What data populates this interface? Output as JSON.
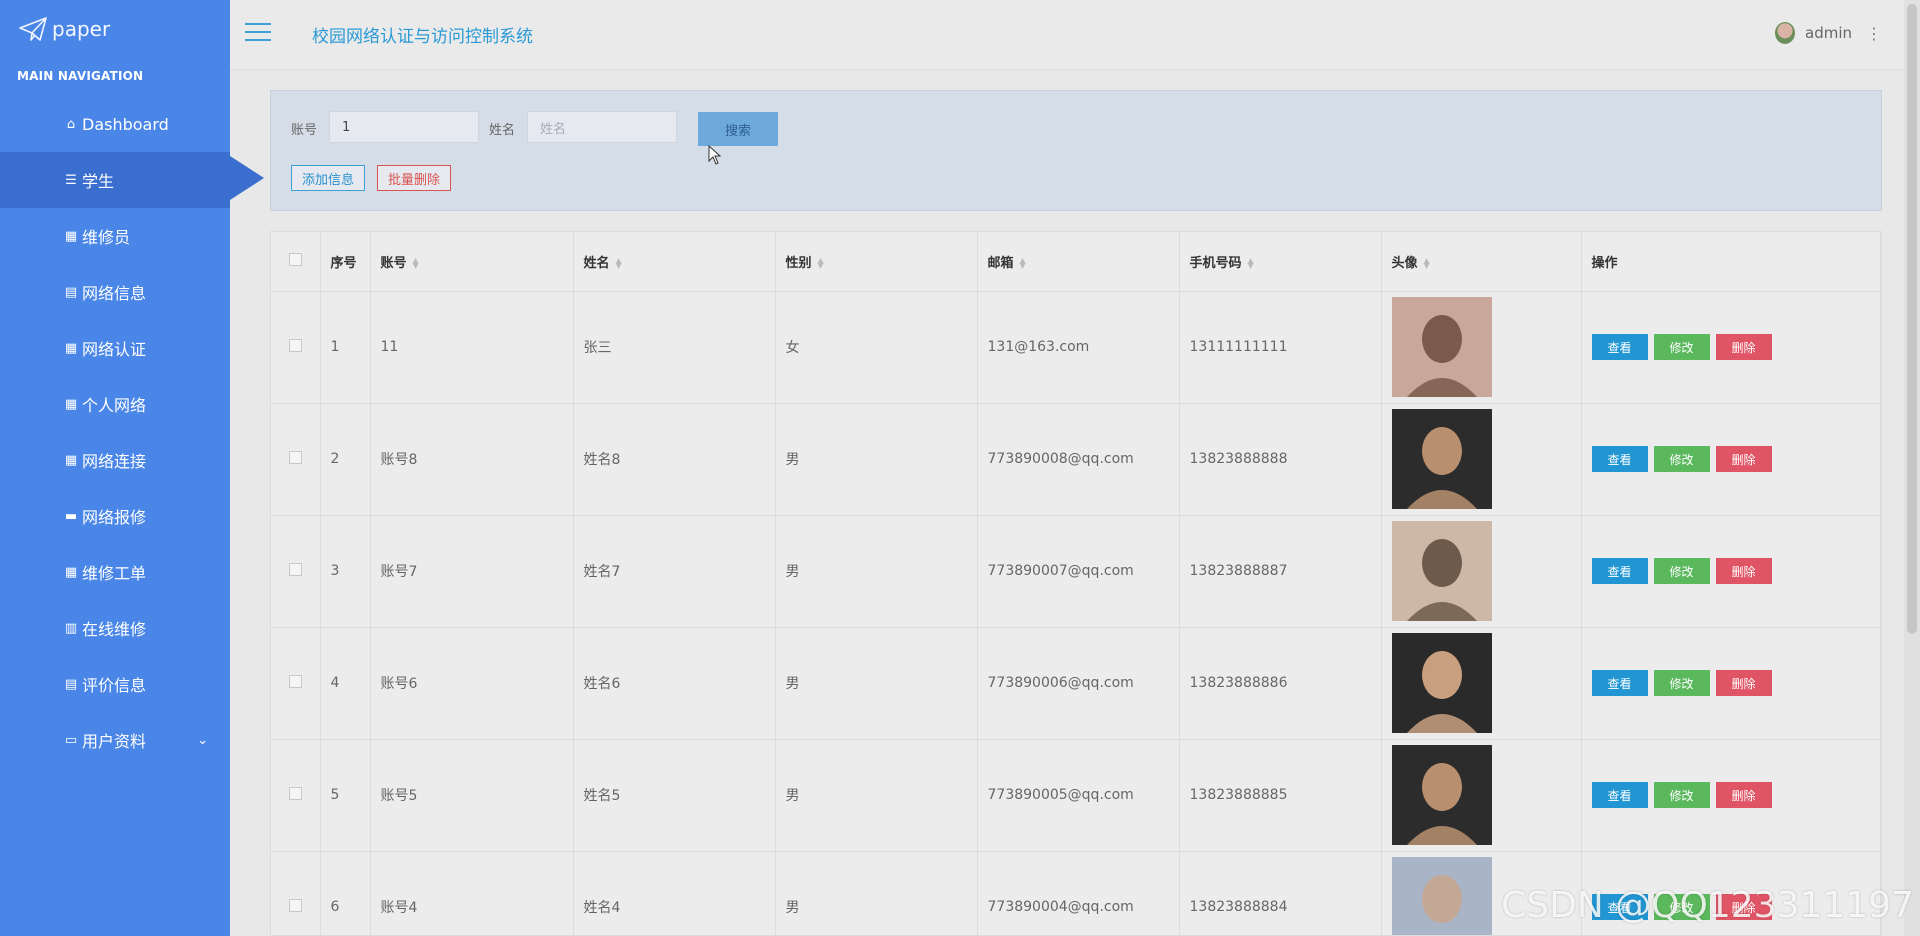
{
  "app": {
    "logo_text": "paper",
    "title": "校园网络认证与访问控制系统"
  },
  "sidebar": {
    "section_title": "MAIN NAVIGATION",
    "items": [
      {
        "label": "Dashboard",
        "icon": "home-icon"
      },
      {
        "label": "学生",
        "icon": "list-icon",
        "active": true
      },
      {
        "label": "维修员",
        "icon": "grid-icon"
      },
      {
        "label": "网络信息",
        "icon": "clipboard-icon"
      },
      {
        "label": "网络认证",
        "icon": "grid-icon"
      },
      {
        "label": "个人网络",
        "icon": "grid-icon"
      },
      {
        "label": "网络连接",
        "icon": "grid-icon"
      },
      {
        "label": "网络报修",
        "icon": "briefcase-icon"
      },
      {
        "label": "维修工单",
        "icon": "grid-icon"
      },
      {
        "label": "在线维修",
        "icon": "book-icon"
      },
      {
        "label": "评价信息",
        "icon": "clipboard-icon"
      },
      {
        "label": "用户资料",
        "icon": "card-icon",
        "has_children": true
      }
    ]
  },
  "user": {
    "name": "admin"
  },
  "search": {
    "account_label": "账号",
    "account_value": "1",
    "name_label": "姓名",
    "name_placeholder": "姓名",
    "search_button": "搜索",
    "add_button": "添加信息",
    "batch_delete_button": "批量删除"
  },
  "table": {
    "headers": {
      "index": "序号",
      "account": "账号",
      "name": "姓名",
      "gender": "性别",
      "email": "邮箱",
      "phone": "手机号码",
      "avatar": "头像",
      "actions": "操作"
    },
    "actions": {
      "view": "查看",
      "edit": "修改",
      "delete": "删除"
    },
    "rows": [
      {
        "index": "1",
        "account": "11",
        "name": "张三",
        "gender": "女",
        "email": "131@163.com",
        "phone": "13111111111"
      },
      {
        "index": "2",
        "account": "账号8",
        "name": "姓名8",
        "gender": "男",
        "email": "773890008@qq.com",
        "phone": "13823888888"
      },
      {
        "index": "3",
        "account": "账号7",
        "name": "姓名7",
        "gender": "男",
        "email": "773890007@qq.com",
        "phone": "13823888887"
      },
      {
        "index": "4",
        "account": "账号6",
        "name": "姓名6",
        "gender": "男",
        "email": "773890006@qq.com",
        "phone": "13823888886"
      },
      {
        "index": "5",
        "account": "账号5",
        "name": "姓名5",
        "gender": "男",
        "email": "773890005@qq.com",
        "phone": "13823888885"
      },
      {
        "index": "6",
        "account": "账号4",
        "name": "姓名4",
        "gender": "男",
        "email": "773890004@qq.com",
        "phone": "13823888884"
      }
    ]
  },
  "watermark": "CSDN @QQ123311197",
  "colors": {
    "sidebar": "#4a86e8",
    "sidebar_active": "#3a6fd0",
    "title": "#2a9ad6",
    "view": "#2196d3",
    "edit": "#5cb85c",
    "delete": "#e05565"
  }
}
